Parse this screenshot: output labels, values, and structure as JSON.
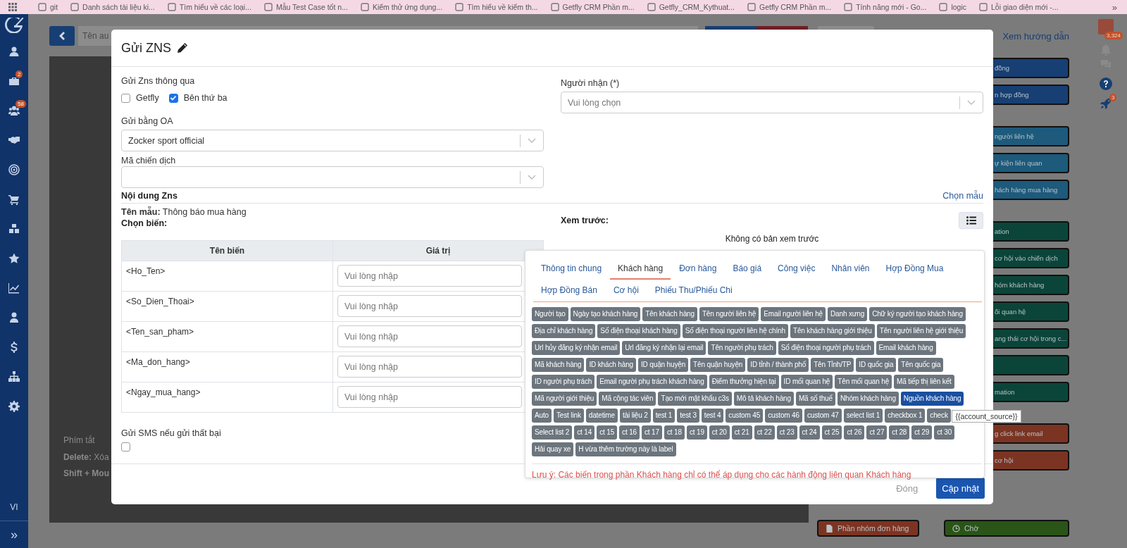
{
  "bookmarks": [
    {
      "label": "git"
    },
    {
      "label": "Danh sách tài liệu ki..."
    },
    {
      "label": "Tìm hiểu về các loại..."
    },
    {
      "label": "Mẫu Test Case tốt n..."
    },
    {
      "label": "Kiểm thử ứng dụng..."
    },
    {
      "label": "Tìm hiểu về kiểm th..."
    },
    {
      "label": "Getfly CRM Phần m..."
    },
    {
      "label": "Getfly_CRM_Kythuat..."
    },
    {
      "label": "Getfly CRM Phần m..."
    },
    {
      "label": "Tính năng mới - Go..."
    },
    {
      "label": "logic"
    },
    {
      "label": "Lỗi giao diện mới -..."
    }
  ],
  "bookmarks_more": "»",
  "sidebar": {
    "items": [
      {
        "kind": "user"
      },
      {
        "kind": "briefcase",
        "badge": "2"
      },
      {
        "kind": "users",
        "badge": "58"
      },
      {
        "kind": "handshake"
      },
      {
        "kind": "target"
      },
      {
        "kind": "cart"
      },
      {
        "kind": "cubes"
      },
      {
        "kind": "star"
      },
      {
        "kind": "chart"
      },
      {
        "kind": "person"
      },
      {
        "kind": "dollar"
      },
      {
        "kind": "sitemap"
      },
      {
        "kind": "gear"
      }
    ],
    "language": "VI",
    "expand": "»"
  },
  "toolbar": {
    "search_placeholder": "Tên au",
    "help_link": "Xem hướng dẫn"
  },
  "shortcuts": {
    "title": "Phím tắt",
    "lines": [
      {
        "key": "Delete:",
        "text": "Xóa"
      },
      {
        "key": "Shift + Mou"
      }
    ]
  },
  "workflow_panel": {
    "groups": [
      {
        "items": [
          {
            "label": "đồng",
            "color": "#173f73"
          },
          {
            "label": "n hợp đồng",
            "color": "#173f73"
          }
        ]
      },
      {
        "items": [
          {
            "label": "người liên hệ",
            "color": "#1d5a7c"
          },
          {
            "label": "ự kiện liên quan",
            "color": "#1d5a7c"
          },
          {
            "label": "hách hàng mua hàng",
            "color": "#1d5a7c"
          }
        ]
      },
      {
        "items": [
          {
            "label": "ation",
            "color": "#0b4539"
          },
          {
            "label": "cơ hội vào chiến dịch",
            "color": "#0b4539"
          },
          {
            "label": "hóm khách hàng",
            "color": "#0b4539"
          },
          {
            "label": "ối quan hệ",
            "color": "#0b4539"
          },
          {
            "label": "ang thái cơ hội trong c...",
            "color": "#0b4539"
          },
          {
            "color": "#0b4539"
          },
          {
            "label": "mation",
            "color": "#0b4539"
          }
        ]
      },
      {
        "items": [
          {
            "label": "g click link email",
            "color": "#7c3422"
          },
          {
            "label": "cơ hội",
            "color": "#7c3422"
          }
        ]
      }
    ],
    "bottom_row": [
      {
        "label": "Phần nhóm đơn hàng",
        "color": "#7c3422",
        "kind": "list"
      },
      {
        "label": "Chờ",
        "color": "#2b5418",
        "kind": "clock"
      }
    ]
  },
  "top_icons": {
    "notification_badge": "3,324",
    "rocket_badge": "3"
  },
  "modal": {
    "title": "Gửi ZNS",
    "send_via": {
      "label": "Gửi Zns thông qua",
      "options": [
        {
          "label": "Getfly",
          "checked": false
        },
        {
          "label": "Bên thứ ba",
          "checked": true
        }
      ]
    },
    "oa": {
      "label": "Gửi bằng OA",
      "value": "Zocker sport official"
    },
    "campaign": {
      "label": "Mã chiến dịch"
    },
    "recipient": {
      "label": "Người nhận (*)",
      "placeholder": "Vui lòng chọn"
    },
    "content": {
      "heading": "Nội dung Zns",
      "choose_template": "Chọn mẫu",
      "template_label": "Tên mẫu:",
      "template_name": "Thông báo mua hàng",
      "variables_label": "Chọn biến:",
      "preview_label": "Xem trước:",
      "preview_empty": "Không có bản xem trước"
    },
    "table": {
      "columns": [
        "Tên biến",
        "Giá trị"
      ],
      "rows": [
        {
          "variable": "<Ho_Ten>",
          "placeholder": "Vui lòng nhập"
        },
        {
          "variable": "<So_Dien_Thoai>",
          "placeholder": "Vui lòng nhập"
        },
        {
          "variable": "<Ten_san_pham>",
          "placeholder": "Vui lòng nhập"
        },
        {
          "variable": "<Ma_don_hang>",
          "placeholder": "Vui lòng nhập"
        },
        {
          "variable": "<Ngay_mua_hang>",
          "placeholder": "Vui lòng nhập"
        }
      ]
    },
    "sms_fallback": {
      "label": "Gửi SMS nếu gửi thất bại",
      "checked": false
    },
    "buttons": [
      {
        "label": "Đóng",
        "kind": "secondary"
      },
      {
        "label": "Cập nhật",
        "kind": "primary"
      }
    ]
  },
  "variable_picker": {
    "tabs": [
      {
        "label": "Thông tin chung",
        "selected": false
      },
      {
        "label": "Khách hàng",
        "selected": true
      },
      {
        "label": "Đơn hàng",
        "selected": false
      },
      {
        "label": "Báo giá",
        "selected": false
      },
      {
        "label": "Công việc",
        "selected": false
      },
      {
        "label": "Nhân viên",
        "selected": false
      },
      {
        "label": "Hợp Đồng Mua",
        "selected": false
      },
      {
        "label": "Hợp Đồng Bán",
        "selected": false
      },
      {
        "label": "Cơ hội",
        "selected": false
      },
      {
        "label": "Phiếu Thu/Phiếu Chi",
        "selected": false
      }
    ],
    "tags": [
      {
        "label": "Người tạo",
        "selected": false
      },
      {
        "label": "Ngày tạo khách hàng",
        "selected": false
      },
      {
        "label": "Tên khách hàng",
        "selected": false
      },
      {
        "label": "Tên người liên hệ",
        "selected": false
      },
      {
        "label": "Email người liên hệ",
        "selected": false
      },
      {
        "label": "Danh xưng",
        "selected": false
      },
      {
        "label": "Chữ ký người tạo khách hàng",
        "selected": false
      },
      {
        "label": "Địa chỉ khách hàng",
        "selected": false
      },
      {
        "label": "Số điện thoại khách hàng",
        "selected": false
      },
      {
        "label": "Số điện thoại người liên hệ chính",
        "selected": false
      },
      {
        "label": "Tên khách hàng giới thiệu",
        "selected": false
      },
      {
        "label": "Tên người liên hệ giới thiệu",
        "selected": false
      },
      {
        "label": "Url hủy đăng ký nhận email",
        "selected": false
      },
      {
        "label": "Url đăng ký nhận lại email",
        "selected": false
      },
      {
        "label": "Tên người phụ trách",
        "selected": false
      },
      {
        "label": "Số điện thoại người phụ trách",
        "selected": false
      },
      {
        "label": "Email khách hàng",
        "selected": false
      },
      {
        "label": "Mã khách hàng",
        "selected": false
      },
      {
        "label": "ID khách hàng",
        "selected": false
      },
      {
        "label": "ID quận huyện",
        "selected": false
      },
      {
        "label": "Tên quận huyện",
        "selected": false
      },
      {
        "label": "ID tỉnh / thành phố",
        "selected": false
      },
      {
        "label": "Tên Tỉnh/TP",
        "selected": false
      },
      {
        "label": "ID quốc gia",
        "selected": false
      },
      {
        "label": "Tên quốc gia",
        "selected": false
      },
      {
        "label": "ID người phụ trách",
        "selected": false
      },
      {
        "label": "Email người phụ trách khách hàng",
        "selected": false
      },
      {
        "label": "Điểm thưởng hiện tại",
        "selected": false
      },
      {
        "label": "ID mối quan hệ",
        "selected": false
      },
      {
        "label": "Tên mối quan hệ",
        "selected": false
      },
      {
        "label": "Mã tiếp thị liên kết",
        "selected": false
      },
      {
        "label": "Mã người giới thiệu",
        "selected": false
      },
      {
        "label": "Mã cộng tác viên",
        "selected": false
      },
      {
        "label": "Tạo mới mật khẩu c3s",
        "selected": false
      },
      {
        "label": "Mô tả khách hàng",
        "selected": false
      },
      {
        "label": "Mã số thuế",
        "selected": false
      },
      {
        "label": "Nhóm khách hàng",
        "selected": false
      },
      {
        "label": "Nguồn khách hàng",
        "selected": true
      },
      {
        "label": "Auto",
        "selected": false
      },
      {
        "label": "Test link",
        "selected": false
      },
      {
        "label": "datetime",
        "selected": false
      },
      {
        "label": "tài liệu 2",
        "selected": false
      },
      {
        "label": "test 1",
        "selected": false
      },
      {
        "label": "test 3",
        "selected": false
      },
      {
        "label": "test 4",
        "selected": false
      },
      {
        "label": "custom 45",
        "selected": false
      },
      {
        "label": "custom 46",
        "selected": false
      },
      {
        "label": "custom 47",
        "selected": false
      },
      {
        "label": "select list 1",
        "selected": false
      },
      {
        "label": "checkbox 1",
        "selected": false
      },
      {
        "label": "check",
        "selected": false
      },
      {
        "label": "Select list 2",
        "selected": false
      },
      {
        "label": "ct 14",
        "selected": false
      },
      {
        "label": "ct 15",
        "selected": false
      },
      {
        "label": "ct 16",
        "selected": false
      },
      {
        "label": "ct 17",
        "selected": false
      },
      {
        "label": "ct 18",
        "selected": false
      },
      {
        "label": "ct 19",
        "selected": false
      },
      {
        "label": "ct 20",
        "selected": false
      },
      {
        "label": "ct 21",
        "selected": false
      },
      {
        "label": "ct 22",
        "selected": false
      },
      {
        "label": "ct 23",
        "selected": false
      },
      {
        "label": "ct 24",
        "selected": false
      },
      {
        "label": "ct 25",
        "selected": false
      },
      {
        "label": "ct 26",
        "selected": false
      },
      {
        "label": "ct 27",
        "selected": false
      },
      {
        "label": "ct 28",
        "selected": false
      },
      {
        "label": "ct 29",
        "selected": false
      },
      {
        "label": "ct 30",
        "selected": false
      },
      {
        "label": "Hải quay xe",
        "selected": false
      },
      {
        "label": "H vừa thêm trường này là label",
        "selected": false
      }
    ],
    "tooltip": "{{account_source}}",
    "note": "Lưu ý: Các biến trong phần Khách hàng chỉ có thể áp dụng cho các hành động liên quan Khách hàng"
  }
}
